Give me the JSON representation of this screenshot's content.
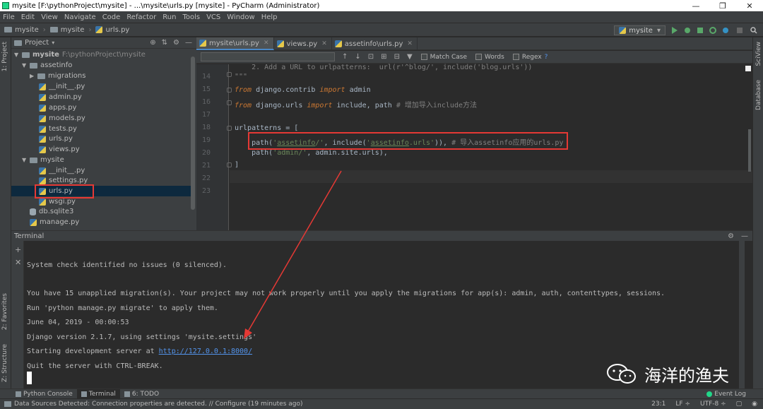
{
  "window": {
    "title": "mysite [F:\\pythonProject\\mysite] - ...\\mysite\\urls.py [mysite] - PyCharm (Administrator)",
    "controls": [
      "—",
      "❐",
      "✕"
    ]
  },
  "menu": [
    "File",
    "Edit",
    "View",
    "Navigate",
    "Code",
    "Refactor",
    "Run",
    "Tools",
    "VCS",
    "Window",
    "Help"
  ],
  "breadcrumb": [
    "mysite",
    "mysite",
    "urls.py"
  ],
  "run_config": "mysite",
  "left_strip": [
    "1: Project",
    "2: Favorites",
    "Z: Structure"
  ],
  "right_strip": [
    "SciView",
    "Database"
  ],
  "project": {
    "title": "Project",
    "root": "mysite",
    "root_path": "F:\\pythonProject\\mysite",
    "items": [
      "assetinfo",
      "migrations",
      "__init__.py",
      "admin.py",
      "apps.py",
      "models.py",
      "tests.py",
      "urls.py",
      "views.py",
      "mysite",
      "__init__.py",
      "settings.py",
      "urls.py",
      "wsgi.py",
      "db.sqlite3",
      "manage.py"
    ]
  },
  "editor": {
    "tabs": [
      "mysite\\urls.py",
      "views.py",
      "assetinfo\\urls.py"
    ],
    "find": {
      "match_case": "Match Case",
      "words": "Words",
      "regex": "Regex",
      "help": "?"
    },
    "line_numbers": [
      "14",
      "15",
      "16",
      "17",
      "18",
      "19",
      "20",
      "21",
      "22",
      "23"
    ],
    "code": {
      "l14": "    2. Add a URL to urlpatterns:  url(r'^blog/', include('blog.urls'))",
      "l15_a": "\"\"\"",
      "l16_kw1": "from",
      "l16_a": " django.contrib ",
      "l16_kw2": "import",
      "l16_b": " admin",
      "l17_kw1": "from",
      "l17_a": " django.urls ",
      "l17_kw2": "import",
      "l17_b": " include, path ",
      "l17_cmt": "# 增加导入include方法",
      "l19_a": "urlpatterns = [",
      "l20_a": "    path(",
      "l20_s1a": "'",
      "l20_s1u": "assetinfo",
      "l20_s1b": "/'",
      "l20_b": ", include(",
      "l20_s2a": "'",
      "l20_s2u": "assetinfo",
      "l20_s2b": ".urls'",
      "l20_c": ")), ",
      "l20_cmt": "# 导入assetinfo应用的urls.py",
      "l21_a": "    path(",
      "l21_s": "'admin/'",
      "l21_b": ", admin.site.urls),",
      "l22_a": "]"
    }
  },
  "terminal": {
    "title": "Terminal",
    "lines": [
      "System check identified no issues (0 silenced).",
      "",
      "You have 15 unapplied migration(s). Your project may not work properly until you apply the migrations for app(s): admin, auth, contenttypes, sessions.",
      "Run 'python manage.py migrate' to apply them.",
      "June 04, 2019 - 00:00:53",
      "Django version 2.1.7, using settings 'mysite.settings'"
    ],
    "server_line_prefix": "Starting development server at ",
    "server_url": "http://127.0.0.1:8000/",
    "quit_line": "Quit the server with CTRL-BREAK."
  },
  "tool_tabs": [
    "Python Console",
    "Terminal",
    "6: TODO"
  ],
  "event_log": "Event Log",
  "status": {
    "message": "Data Sources Detected: Connection properties are detected. // Configure (19 minutes ago)",
    "position": "23:1",
    "line_sep": "LF ÷",
    "encoding": "UTF-8 ÷"
  },
  "watermark": "海洋的渔夫",
  "colors": {
    "annotation": "#e53935",
    "accent": "#4a88c7",
    "link": "#5394ec"
  }
}
